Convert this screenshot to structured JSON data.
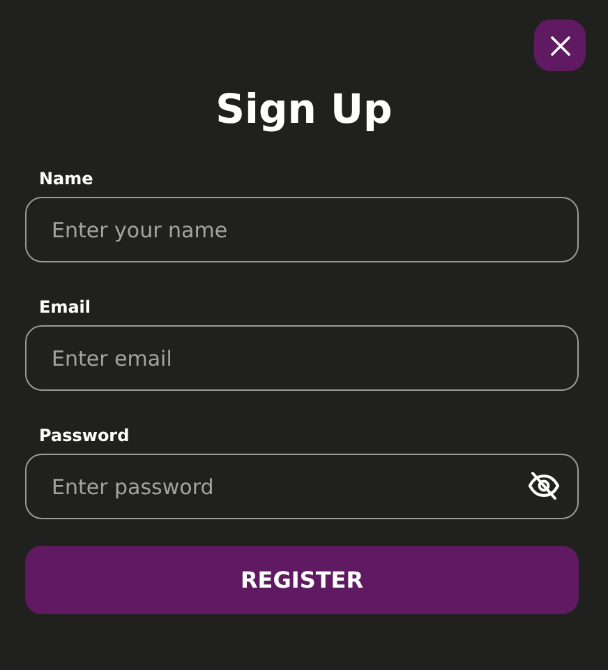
{
  "title": "Sign Up",
  "fields": [
    {
      "label": "Name",
      "placeholder": "Enter your name",
      "kind": "text"
    },
    {
      "label": "Email",
      "placeholder": "Enter email",
      "kind": "email"
    },
    {
      "label": "Password",
      "placeholder": "Enter password",
      "kind": "password"
    }
  ],
  "submit": "REGISTER"
}
